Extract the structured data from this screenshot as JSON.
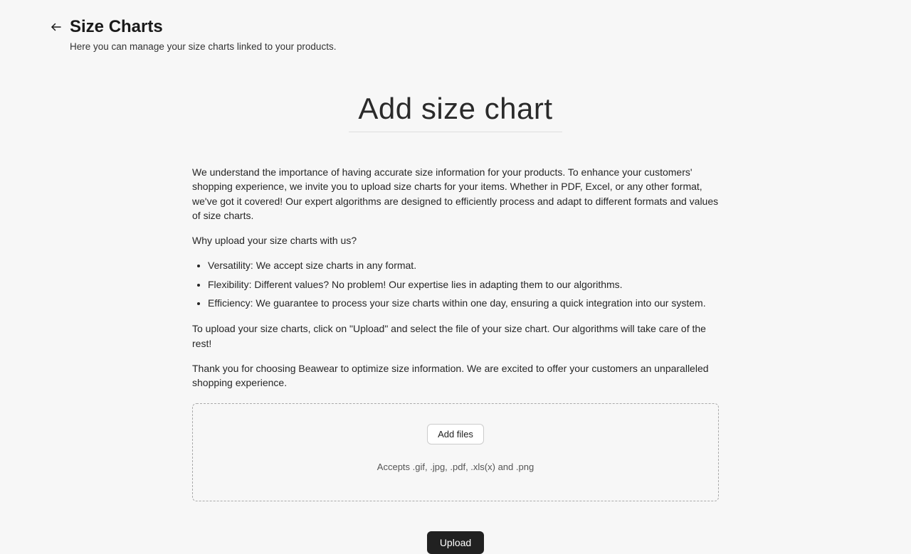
{
  "header": {
    "title": "Size Charts",
    "subtitle": "Here you can manage your size charts linked to your products."
  },
  "main": {
    "heading": "Add size chart",
    "intro": "We understand the importance of having accurate size information for your products. To enhance your customers' shopping experience, we invite you to upload size charts for your items. Whether in PDF, Excel, or any other format, we've got it covered! Our expert algorithms are designed to efficiently process and adapt to different formats and values of size charts.",
    "why_heading": "Why upload your size charts with us?",
    "bullets": [
      "Versatility: We accept size charts in any format.",
      "Flexibility: Different values? No problem! Our expertise lies in adapting them to our algorithms.",
      "Efficiency: We guarantee to process your size charts within one day, ensuring a quick integration into our system."
    ],
    "instruction": "To upload your size charts, click on \"Upload\" and select the file of your size chart. Our algorithms will take care of the rest!",
    "thanks": "Thank you for choosing Beawear to optimize size information. We are excited to offer your customers an unparalleled shopping experience."
  },
  "dropzone": {
    "add_files_label": "Add files",
    "accepts": "Accepts .gif, .jpg, .pdf, .xls(x) and .png"
  },
  "actions": {
    "upload_label": "Upload"
  }
}
